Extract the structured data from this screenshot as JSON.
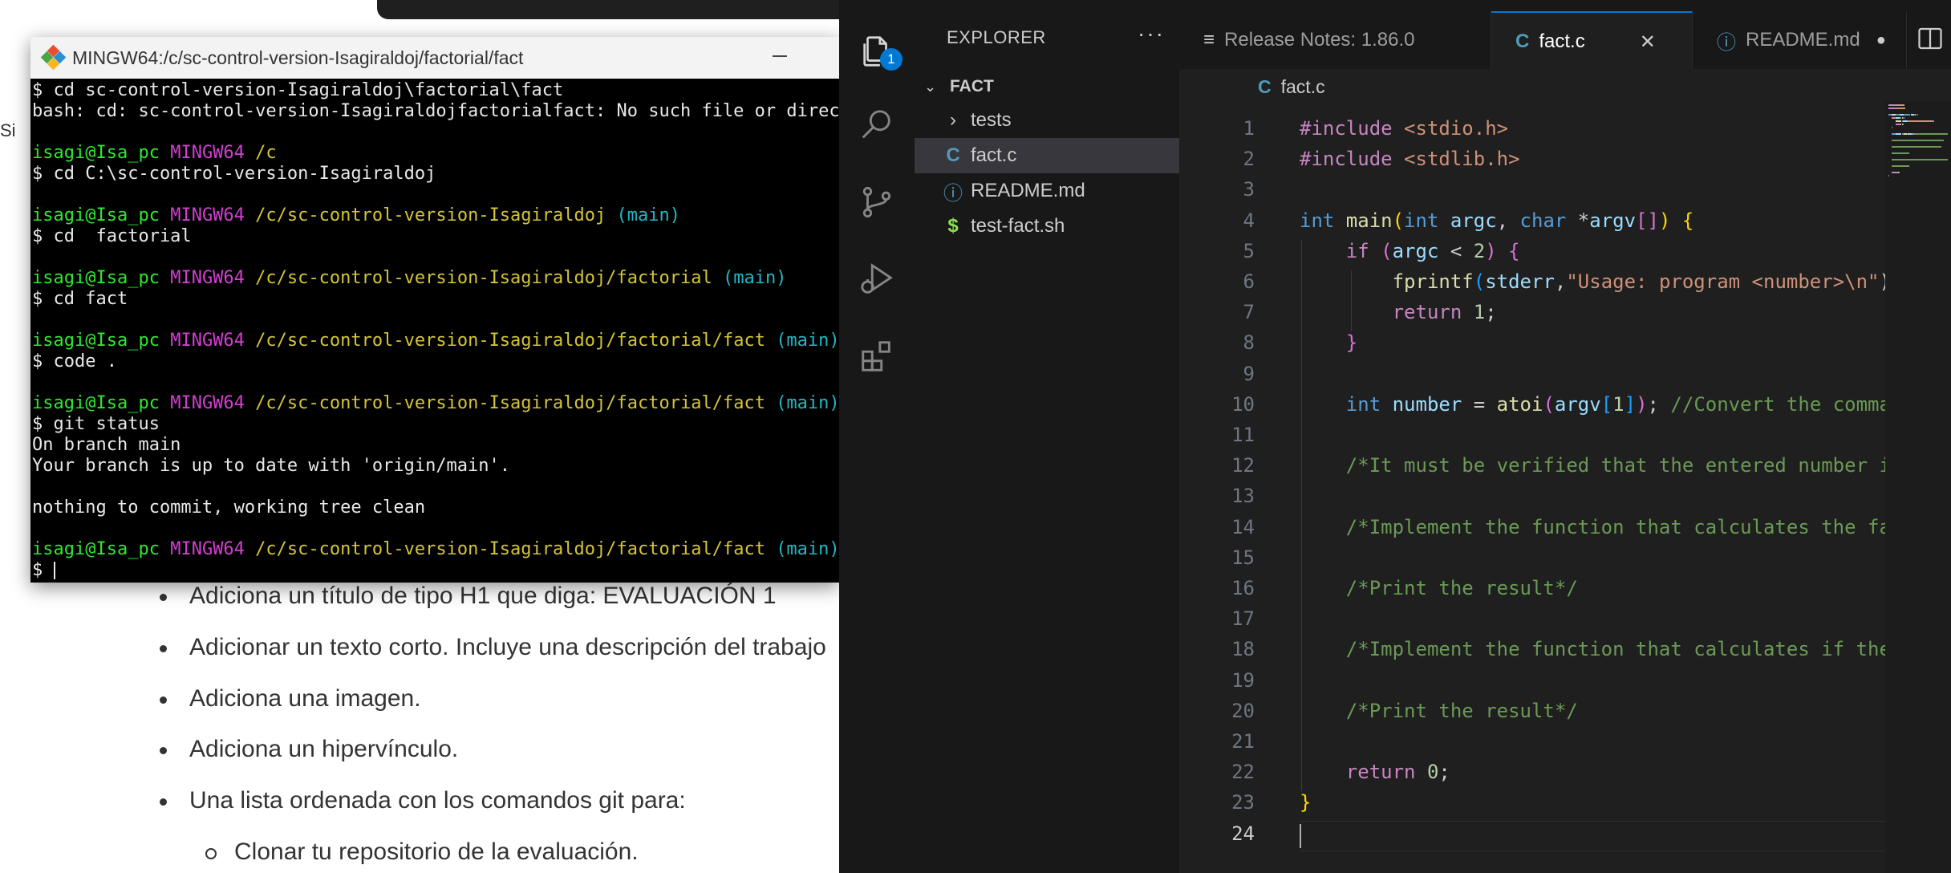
{
  "background_page": {
    "stub_text": "Si",
    "list_items": [
      "Adiciona un título de tipo H1 que diga: EVALUACIÓN 1",
      "Adicionar un texto corto. Incluye una descripción del trabajo",
      "Adiciona una imagen.",
      "Adiciona un hipervínculo.",
      "Una lista ordenada con los comandos git para:"
    ],
    "sub_item": "Clonar tu repositorio de la evaluación."
  },
  "terminal": {
    "title": "MINGW64:/c/sc-control-version-Isagiraldoj/factorial/fact",
    "user": "isagi@Isa_pc",
    "host": "MINGW64",
    "lines": [
      {
        "cmd": "$ cd sc-control-version-Isagiraldoj\\factorial\\fact"
      },
      {
        "out": "bash: cd: sc-control-version-Isagiraldojfactorialfact: No such file or directory"
      },
      {
        "blank": ""
      },
      {
        "path": "/c",
        "branch": ""
      },
      {
        "cmd": "$ cd C:\\sc-control-version-Isagiraldoj"
      },
      {
        "blank": ""
      },
      {
        "path": "/c/sc-control-version-Isagiraldoj",
        "branch": "(main)"
      },
      {
        "cmd": "$ cd  factorial"
      },
      {
        "blank": ""
      },
      {
        "path": "/c/sc-control-version-Isagiraldoj/factorial",
        "branch": "(main)"
      },
      {
        "cmd": "$ cd fact"
      },
      {
        "blank": ""
      },
      {
        "path": "/c/sc-control-version-Isagiraldoj/factorial/fact",
        "branch": "(main)"
      },
      {
        "cmd": "$ code ."
      },
      {
        "blank": ""
      },
      {
        "path": "/c/sc-control-version-Isagiraldoj/factorial/fact",
        "branch": "(main)"
      },
      {
        "cmd": "$ git status"
      },
      {
        "out": "On branch main"
      },
      {
        "out": "Your branch is up to date with 'origin/main'."
      },
      {
        "blank": ""
      },
      {
        "out": "nothing to commit, working tree clean"
      },
      {
        "blank": ""
      },
      {
        "path": "/c/sc-control-version-Isagiraldoj/factorial/fact",
        "branch": "(main)"
      },
      {
        "prompt": "$ "
      }
    ]
  },
  "vscode": {
    "activity_badge": "1",
    "explorer": {
      "title": "EXPLORER",
      "more": "···",
      "folder": "FACT",
      "items": [
        {
          "icon": "›",
          "label": "tests",
          "kind": "folder"
        },
        {
          "icon": "C",
          "label": "fact.c",
          "kind": "c",
          "selected": true
        },
        {
          "icon": "ⓘ",
          "label": "README.md",
          "kind": "md"
        },
        {
          "icon": "$",
          "label": "test-fact.sh",
          "kind": "sh"
        }
      ]
    },
    "tabs": [
      {
        "icon": "≡",
        "label": "Release Notes: 1.86.0"
      },
      {
        "icon": "C",
        "label": "fact.c",
        "close": "✕",
        "active": true
      },
      {
        "icon": "ⓘ",
        "label": "README.md",
        "dirty": "●"
      }
    ],
    "breadcrumb": {
      "icon": "C",
      "file": "fact.c"
    },
    "current_line": 24,
    "code_lines": [
      [
        [
          "#include ",
          "k-ctrl"
        ],
        [
          "<stdio.h>",
          "k-str"
        ]
      ],
      [
        [
          "#include ",
          "k-ctrl"
        ],
        [
          "<stdlib.h>",
          "k-str"
        ]
      ],
      [],
      [
        [
          "int ",
          "k-type"
        ],
        [
          "main",
          "k-fn"
        ],
        [
          "(",
          "k-br1"
        ],
        [
          "int ",
          "k-type"
        ],
        [
          "argc",
          "k-var"
        ],
        [
          ", ",
          ""
        ],
        [
          "char ",
          "k-type"
        ],
        [
          "*",
          ""
        ],
        [
          "argv",
          "k-var"
        ],
        [
          "[]",
          "k-br2"
        ],
        [
          ")",
          "k-br1"
        ],
        [
          " ",
          ""
        ],
        [
          "{",
          "k-br1"
        ]
      ],
      [
        [
          "    ",
          ""
        ],
        [
          "if ",
          "k-ctrl"
        ],
        [
          "(",
          "k-br2"
        ],
        [
          "argc ",
          "k-var"
        ],
        [
          "< ",
          ""
        ],
        [
          "2",
          "k-num"
        ],
        [
          ")",
          "k-br2"
        ],
        [
          " ",
          ""
        ],
        [
          "{",
          "k-br2"
        ]
      ],
      [
        [
          "        ",
          ""
        ],
        [
          "fprintf",
          "k-fn"
        ],
        [
          "(",
          "k-br3"
        ],
        [
          "stderr",
          "k-var"
        ],
        [
          ",",
          ""
        ],
        [
          "\"Usage: program <number>\\n\"",
          "k-str"
        ],
        [
          ");",
          ""
        ]
      ],
      [
        [
          "        ",
          ""
        ],
        [
          "return ",
          "k-ctrl"
        ],
        [
          "1",
          "k-num"
        ],
        [
          ";",
          ""
        ]
      ],
      [
        [
          "    ",
          ""
        ],
        [
          "}",
          "k-br2"
        ]
      ],
      [],
      [
        [
          "    ",
          ""
        ],
        [
          "int ",
          "k-type"
        ],
        [
          "number ",
          "k-var"
        ],
        [
          "= ",
          ""
        ],
        [
          "atoi",
          "k-fn"
        ],
        [
          "(",
          "k-br2"
        ],
        [
          "argv",
          "k-var"
        ],
        [
          "[",
          "k-br3"
        ],
        [
          "1",
          "k-num"
        ],
        [
          "]",
          "k-br3"
        ],
        [
          ")",
          "k-br2"
        ],
        [
          "; ",
          ""
        ],
        [
          "//Convert the command line argument to integer",
          "k-cmt"
        ]
      ],
      [],
      [
        [
          "    ",
          ""
        ],
        [
          "/*It must be verified that the entered number is positive*/",
          "k-cmt"
        ]
      ],
      [],
      [
        [
          "    ",
          ""
        ],
        [
          "/*Implement the function that calculates the factorial*/",
          "k-cmt"
        ]
      ],
      [],
      [
        [
          "    ",
          ""
        ],
        [
          "/*Print the result*/",
          "k-cmt"
        ]
      ],
      [],
      [
        [
          "    ",
          ""
        ],
        [
          "/*Implement the function that calculates if the number is prime*/",
          "k-cmt"
        ]
      ],
      [],
      [
        [
          "    ",
          ""
        ],
        [
          "/*Print the result*/",
          "k-cmt"
        ]
      ],
      [],
      [
        [
          "    ",
          ""
        ],
        [
          "return ",
          "k-ctrl"
        ],
        [
          "0",
          "k-num"
        ],
        [
          ";",
          ""
        ]
      ],
      [
        [
          "}",
          "k-br1"
        ]
      ],
      []
    ],
    "colors": {
      "accent": "#0078d4",
      "c_icon": "#519aba",
      "shell_icon": "#89e051",
      "md_icon": "#519aba"
    }
  }
}
